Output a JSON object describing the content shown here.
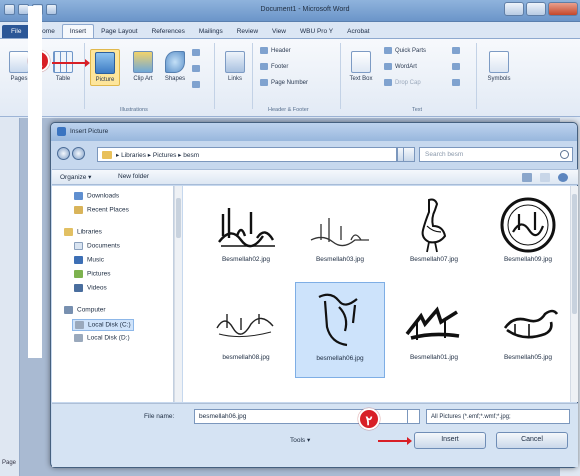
{
  "word": {
    "title": "Document1 - Microsoft Word",
    "tabs": [
      "File",
      "Home",
      "Insert",
      "Page Layout",
      "References",
      "Mailings",
      "Review",
      "View",
      "WBU Pro Y",
      "Acrobat"
    ],
    "ribbon": {
      "pages": "Pages",
      "table": "Table",
      "picture": "Picture",
      "clip_art": "Clip Art",
      "shapes": "Shapes",
      "links": "Links",
      "header": "Header",
      "footer": "Footer",
      "page_number": "Page Number",
      "text_box": "Text Box",
      "quick_parts": "Quick Parts",
      "wordart": "WordArt",
      "drop_cap": "Drop Cap",
      "symbols": "Symbols",
      "group_illustrations": "Illustrations",
      "group_header_footer": "Header & Footer",
      "group_text": "Text"
    },
    "step1": "1",
    "page_label": "Page"
  },
  "dialog": {
    "title": "Insert Picture",
    "address": "▸ Libraries ▸ Pictures ▸ besm",
    "search_placeholder": "Search besm",
    "organize": "Organize ▾",
    "new_folder": "New folder",
    "nav_items": [
      "Downloads",
      "Recent Places",
      "Libraries",
      "Documents",
      "Music",
      "Pictures",
      "Videos",
      "Computer",
      "Local Disk (C:)",
      "Local Disk (D:)"
    ],
    "files": [
      {
        "name": "Besmellah02.jpg"
      },
      {
        "name": "Besmellah03.jpg"
      },
      {
        "name": "Besmellah07.jpg"
      },
      {
        "name": "Besmellah09.jpg"
      },
      {
        "name": "besmellah08.jpg"
      },
      {
        "name": "besmellah06.jpg"
      },
      {
        "name": "Besmellah01.jpg"
      },
      {
        "name": "Besmellah05.jpg"
      }
    ],
    "file_name_label": "File name:",
    "file_name_value": "besmellah06.jpg",
    "filter": "All Pictures (*.emf;*.wmf;*.jpg;",
    "tools": "Tools ▾",
    "insert": "Insert",
    "cancel": "Cancel",
    "step2": "۲"
  },
  "colors": {
    "accent": "#2b5797",
    "badge": "#d81f26",
    "selection": "#cde3fb"
  }
}
